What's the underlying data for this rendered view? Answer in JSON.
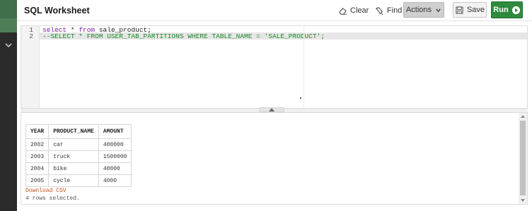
{
  "header": {
    "title": "SQL Worksheet",
    "clear_label": "Clear",
    "find_label": "Find",
    "actions_label": "Actions",
    "save_label": "Save",
    "run_label": "Run"
  },
  "colors": {
    "run_button": "#2f8a3f",
    "rail": "#2b2b2b",
    "rail_accent": "#3f6f4c",
    "comment": "#1c8a2a",
    "keyword": "#7b1fa2",
    "download_link": "#c0501c"
  },
  "icons": {
    "clear": "eraser-icon",
    "find": "flashlight-icon",
    "actions": "chevron-down-icon",
    "save": "save-icon",
    "run": "play-circle-icon",
    "rail": "chevron-down-icon",
    "splitter": "chevron-up-icon"
  },
  "editor": {
    "lines": [
      {
        "number": "1",
        "kw1": "select",
        "mid": " * ",
        "kw2": "from",
        "rest": " sale_product;"
      },
      {
        "number": "2",
        "comment": "--SELECT * FROM USER_TAB_PARTITIONS WHERE TABLE_NAME = 'SALE_PRODUCT';"
      }
    ]
  },
  "results": {
    "columns": [
      "YEAR",
      "PRODUCT_NAME",
      "AMOUNT"
    ],
    "rows": [
      [
        "2002",
        "car",
        "400000"
      ],
      [
        "2003",
        "truck",
        "1500000"
      ],
      [
        "2004",
        "bike",
        "40000"
      ],
      [
        "2005",
        "cycle",
        "4000"
      ]
    ],
    "download_label": "Download CSV",
    "row_count_text": "4 rows selected."
  }
}
